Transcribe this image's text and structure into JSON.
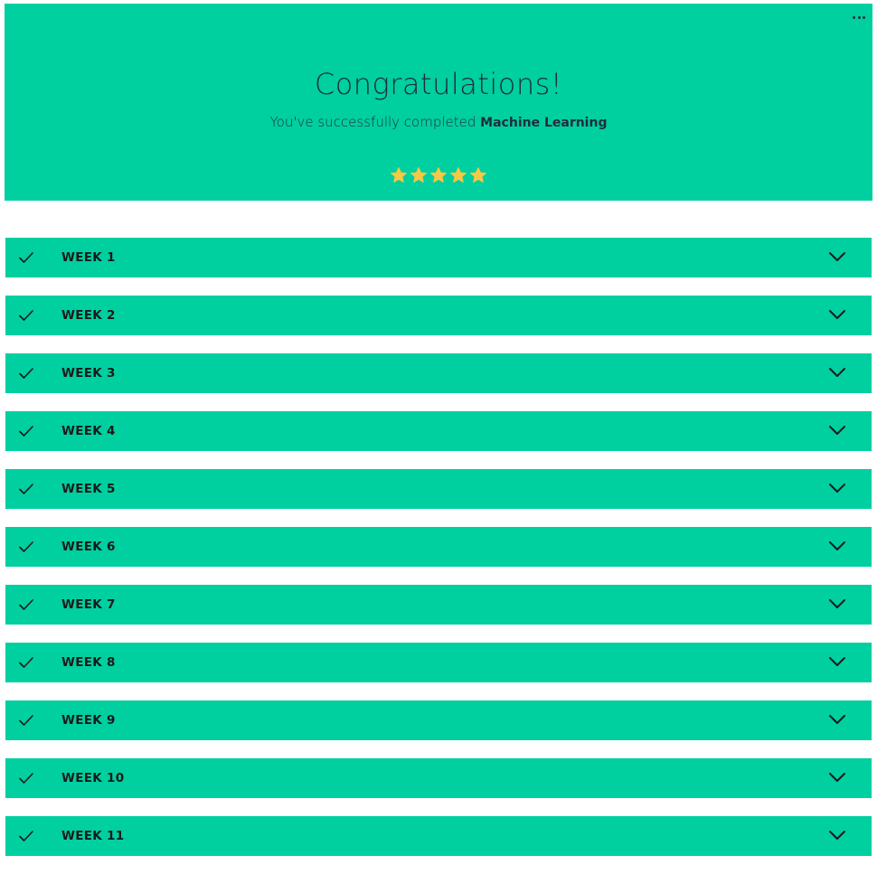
{
  "hero": {
    "title": "Congratulations!",
    "subtitle_prefix": "You've successfully completed ",
    "course_name": "Machine Learning",
    "rating": 5,
    "rating_max": 5,
    "star_color": "#F6C844"
  },
  "colors": {
    "accent": "#00CFA0",
    "text_dark": "#1f2d3a"
  },
  "menu": {
    "icon": "more-horizontal-icon"
  },
  "weeks": [
    {
      "label": "WEEK 1",
      "completed": true
    },
    {
      "label": "WEEK 2",
      "completed": true
    },
    {
      "label": "WEEK 3",
      "completed": true
    },
    {
      "label": "WEEK 4",
      "completed": true
    },
    {
      "label": "WEEK 5",
      "completed": true
    },
    {
      "label": "WEEK 6",
      "completed": true
    },
    {
      "label": "WEEK 7",
      "completed": true
    },
    {
      "label": "WEEK 8",
      "completed": true
    },
    {
      "label": "WEEK 9",
      "completed": true
    },
    {
      "label": "WEEK 10",
      "completed": true
    },
    {
      "label": "WEEK 11",
      "completed": true
    }
  ]
}
